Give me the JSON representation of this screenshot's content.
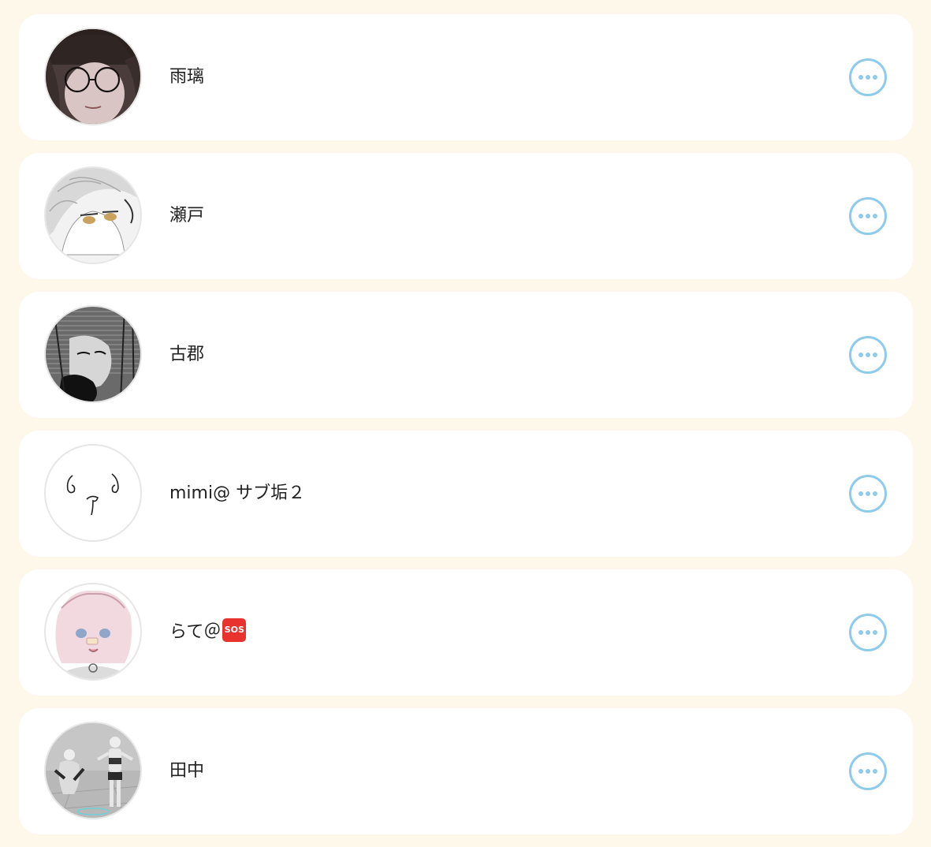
{
  "users": [
    {
      "name": "雨璃",
      "avatar_icon": "user-avatar-icon"
    },
    {
      "name": "瀬戸",
      "avatar_icon": "user-avatar-icon"
    },
    {
      "name": "古郡",
      "avatar_icon": "user-avatar-icon"
    },
    {
      "name": "mimi@ サブ垢２",
      "avatar_icon": "user-avatar-icon"
    },
    {
      "name": "らて＠",
      "badge": "SOS",
      "avatar_icon": "user-avatar-icon"
    },
    {
      "name": "田中",
      "avatar_icon": "user-avatar-icon"
    }
  ],
  "more_icon": "more-horizontal-icon",
  "colors": {
    "background": "#fef8ea",
    "card": "#ffffff",
    "accent": "#8ecbea",
    "sos": "#e8322e"
  }
}
